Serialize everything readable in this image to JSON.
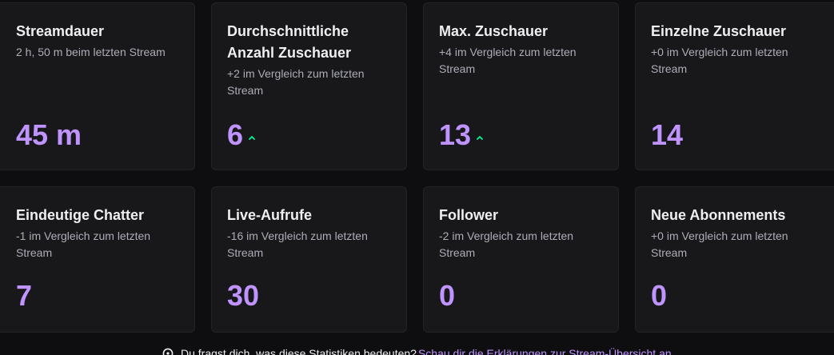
{
  "cards": [
    {
      "title": "Streamdauer",
      "subtitle": "2 h, 50 m beim letzten Stream",
      "value": "45 m",
      "trend": ""
    },
    {
      "title": "Durchschnittliche Anzahl Zuschauer",
      "subtitle": "+2 im Vergleich zum letzten Stream",
      "value": "6",
      "trend": "up"
    },
    {
      "title": "Max. Zuschauer",
      "subtitle": "+4 im Vergleich zum letzten Stream",
      "value": "13",
      "trend": "up"
    },
    {
      "title": "Einzelne Zuschauer",
      "subtitle": "+0 im Vergleich zum letzten Stream",
      "value": "14",
      "trend": ""
    },
    {
      "title": "Eindeutige Chatter",
      "subtitle": "-1 im Vergleich zum letzten Stream",
      "value": "7",
      "trend": ""
    },
    {
      "title": "Live-Aufrufe",
      "subtitle": "-16 im Vergleich zum letzten Stream",
      "value": "30",
      "trend": ""
    },
    {
      "title": "Follower",
      "subtitle": "-2 im Vergleich zum letzten Stream",
      "value": "0",
      "trend": ""
    },
    {
      "title": "Neue Abonnements",
      "subtitle": "+0 im Vergleich zum letzten Stream",
      "value": "0",
      "trend": ""
    }
  ],
  "footer": {
    "question": "Du fragst dich, was diese Statistiken bedeuten?",
    "link": "Schau dir die Erklärungen zur Stream-Übersicht an."
  },
  "colors": {
    "accent": "#bf94ff",
    "trend_up": "#00f593",
    "card_bg": "#18181b",
    "page_bg": "#0e0e10"
  }
}
